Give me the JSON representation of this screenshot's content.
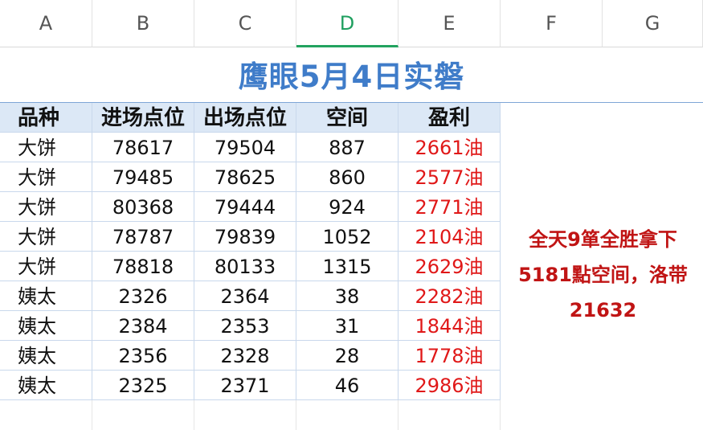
{
  "columns": [
    "A",
    "B",
    "C",
    "D",
    "E",
    "F",
    "G"
  ],
  "selected_column": "D",
  "title": "鹰眼5月4日实磐",
  "table": {
    "headers": [
      "品种",
      "进场点位",
      "出场点位",
      "空间",
      "盈利"
    ],
    "rows": [
      [
        "大饼",
        "78617",
        "79504",
        "887",
        "2661油"
      ],
      [
        "大饼",
        "79485",
        "78625",
        "860",
        "2577油"
      ],
      [
        "大饼",
        "80368",
        "79444",
        "924",
        "2771油"
      ],
      [
        "大饼",
        "78787",
        "79839",
        "1052",
        "2104油"
      ],
      [
        "大饼",
        "78818",
        "80133",
        "1315",
        "2629油"
      ],
      [
        "姨太",
        "2326",
        "2364",
        "38",
        "2282油"
      ],
      [
        "姨太",
        "2384",
        "2353",
        "31",
        "1844油"
      ],
      [
        "姨太",
        "2356",
        "2328",
        "28",
        "1778油"
      ],
      [
        "姨太",
        "2325",
        "2371",
        "46",
        "2986油"
      ]
    ]
  },
  "summary_lines": [
    "全天9箪全胜拿下",
    "5181點空间，洛带",
    "21632"
  ],
  "colors": {
    "title": "#3f7cc9",
    "header_fill": "#dce8f6",
    "profit": "#e01818",
    "summary": "#c01414",
    "selected_column": "#22a35f"
  }
}
